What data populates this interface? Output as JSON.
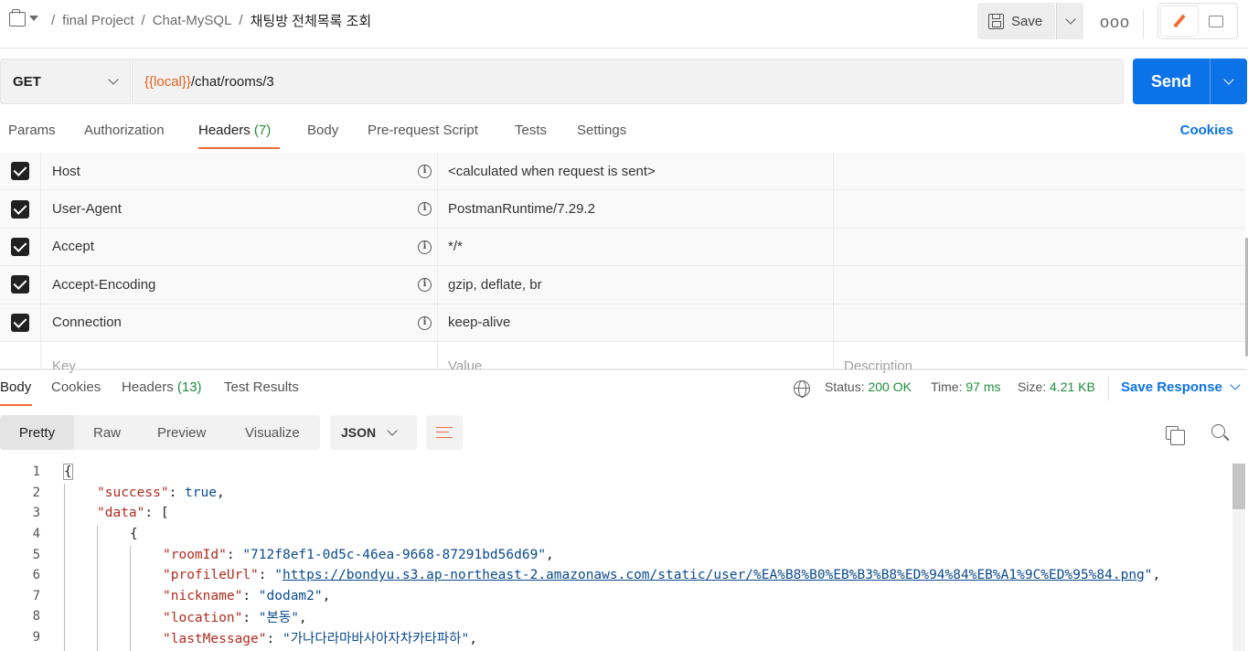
{
  "breadcrumb": {
    "items": [
      "final Project",
      "Chat-MySQL"
    ],
    "current": "채팅방 전체목록 조회",
    "separator": "/"
  },
  "toolbar": {
    "save_label": "Save",
    "more_label": "ooo"
  },
  "request": {
    "method": "GET",
    "url_variable": "{{local}}",
    "url_path": "/chat/rooms/3",
    "send_label": "Send"
  },
  "request_tabs": {
    "params": "Params",
    "authorization": "Authorization",
    "headers": "Headers",
    "headers_count": "(7)",
    "body": "Body",
    "prerequest": "Pre-request Script",
    "tests": "Tests",
    "settings": "Settings",
    "cookies": "Cookies"
  },
  "headers": [
    {
      "key": "Host",
      "value": "<calculated when request is sent>"
    },
    {
      "key": "User-Agent",
      "value": "PostmanRuntime/7.29.2"
    },
    {
      "key": "Accept",
      "value": "*/*"
    },
    {
      "key": "Accept-Encoding",
      "value": "gzip, deflate, br"
    },
    {
      "key": "Connection",
      "value": "keep-alive"
    }
  ],
  "headers_placeholder": {
    "key": "Key",
    "value": "Value",
    "description": "Description"
  },
  "response_tabs": {
    "body": "Body",
    "cookies": "Cookies",
    "headers": "Headers",
    "headers_count": "(13)",
    "test_results": "Test Results"
  },
  "response_status": {
    "status_label": "Status:",
    "status_value": "200 OK",
    "time_label": "Time:",
    "time_value": "97 ms",
    "size_label": "Size:",
    "size_value": "4.21 KB",
    "save_response": "Save Response"
  },
  "view_modes": {
    "pretty": "Pretty",
    "raw": "Raw",
    "preview": "Preview",
    "visualize": "Visualize",
    "format": "JSON"
  },
  "code_lines": {
    "n1": "1",
    "n2": "2",
    "n3": "3",
    "n4": "4",
    "n5": "5",
    "n6": "6",
    "n7": "7",
    "n8": "8",
    "n9": "9",
    "l1_brace": "{",
    "l2_key": "\"success\"",
    "l2_val": "true",
    "l3_key": "\"data\"",
    "l3_rest": ": [",
    "l4_brace": "{",
    "l5_key": "\"roomId\"",
    "l5_val": "\"712f8ef1-0d5c-46ea-9668-87291bd56d69\"",
    "l6_key": "\"profileUrl\"",
    "l6_q": "\"",
    "l6_url": "https://bondyu.s3.ap-northeast-2.amazonaws.com/static/user/%EA%B8%B0%EB%B3%B8%ED%94%84%EB%A1%9C%ED%95%84.png",
    "l7_key": "\"nickname\"",
    "l7_val": "\"dodam2\"",
    "l8_key": "\"location\"",
    "l8_val": "\"본동\"",
    "l9_key": "\"lastMessage\"",
    "l9_val": "\"가나다라마바사아자차카타파하\""
  },
  "colors": {
    "accent": "#f26b3a",
    "send_blue": "#0c72e8",
    "status_green": "#1e8f3e",
    "json_key": "#b12c1e",
    "json_string": "#0b4a8f"
  }
}
